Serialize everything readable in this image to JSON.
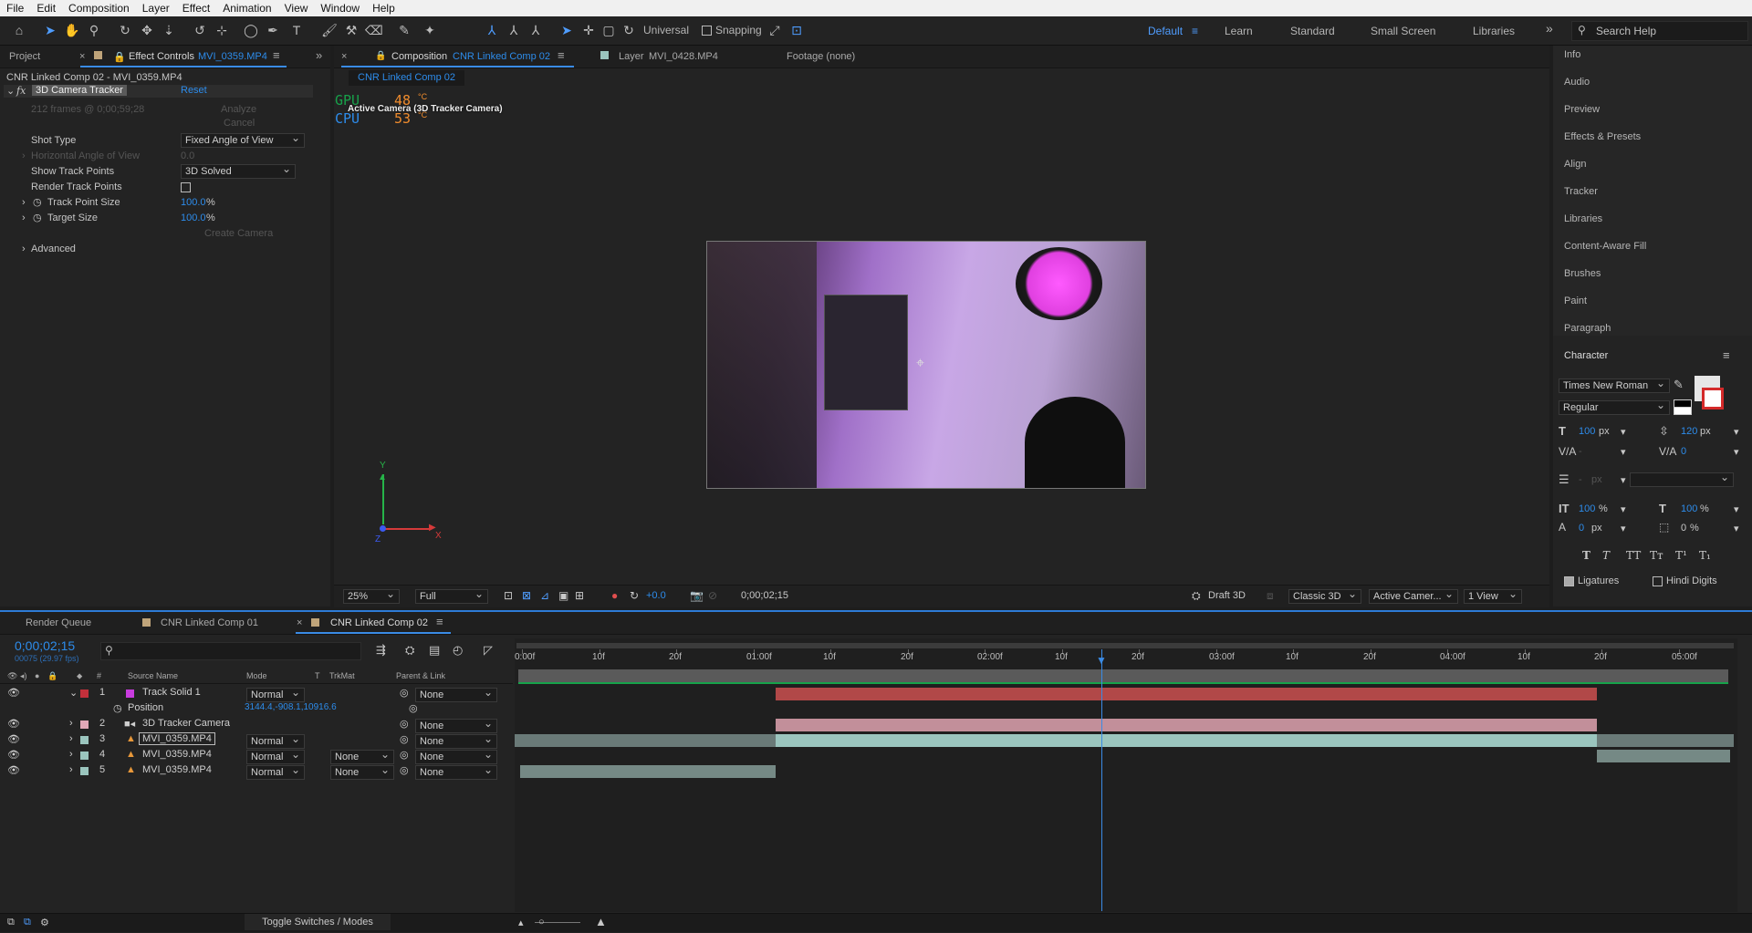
{
  "menu": [
    "File",
    "Edit",
    "Composition",
    "Layer",
    "Effect",
    "Animation",
    "View",
    "Window",
    "Help"
  ],
  "toolbar": {
    "universal_label": "Universal",
    "snapping_label": "Snapping",
    "workspaces": [
      "Default",
      "Learn",
      "Standard",
      "Small Screen",
      "Libraries"
    ],
    "active_workspace": "Default",
    "search_placeholder": "Search Help"
  },
  "left_panel": {
    "tabs": [
      "Project",
      "Effect Controls"
    ],
    "effect_controls_layer": "MVI_0359.MP4",
    "header": "CNR  Linked Comp 02 - MVI_0359.MP4",
    "effect_name": "3D Camera Tracker",
    "reset_label": "Reset",
    "frames_info": "212 frames @ 0;00;59;28",
    "analyze_label": "Analyze",
    "cancel_label": "Cancel",
    "shot_type_label": "Shot Type",
    "shot_type_value": "Fixed Angle of View",
    "hav_label": "Horizontal Angle of View",
    "hav_value": "0.0",
    "show_track_points_label": "Show Track Points",
    "show_track_points_value": "3D Solved",
    "render_track_points_label": "Render Track Points",
    "track_point_size_label": "Track Point Size",
    "track_point_size_value": "100.0",
    "target_size_label": "Target Size",
    "target_size_value": "100.0",
    "percent": "%",
    "create_camera_label": "Create Camera",
    "advanced_label": "Advanced"
  },
  "comp_panel": {
    "tab_prefix": "Composition",
    "tab_comp": "CNR  Linked Comp 02",
    "layer_tab_prefix": "Layer",
    "layer_tab_name": "MVI_0428.MP4",
    "footage_tab": "Footage (none)",
    "breadcrumb": "CNR  Linked Comp 02",
    "active_camera_label": "Active Camera (3D Tracker Camera)",
    "gpu_label": "GPU",
    "gpu_temp": "48",
    "cpu_label": "CPU",
    "cpu_temp": "53",
    "temp_unit": "°C",
    "axis_y": "Y",
    "axis_x": "X",
    "axis_z": "Z",
    "zoom": "25%",
    "resolution": "Full",
    "exposure": "+0.0",
    "timecode": "0;00;02;15",
    "renderer_label": "Draft 3D",
    "renderer": "Classic 3D",
    "camera_view": "Active Camer...",
    "views": "1 View"
  },
  "right_panel": {
    "items": [
      "Info",
      "Audio",
      "Preview",
      "Effects & Presets",
      "Align",
      "Tracker",
      "Libraries",
      "Content-Aware Fill",
      "Brushes",
      "Paint",
      "Paragraph"
    ],
    "character_title": "Character",
    "font_family": "Times New Roman",
    "font_style": "Regular",
    "font_size": "100",
    "leading": "120",
    "px": "px",
    "kerning": "-",
    "tracking": "0",
    "stroke_width": "-",
    "vert_scale": "100",
    "horiz_scale": "100",
    "baseline_shift": "0",
    "tsume": "0",
    "pct": "%",
    "ligatures_label": "Ligatures",
    "hindi_digits_label": "Hindi Digits",
    "style_buttons": [
      "T",
      "T",
      "TT",
      "Tт",
      "T¹",
      "T₁"
    ]
  },
  "timeline": {
    "tabs": [
      "Render Queue",
      "CNR  Linked Comp 01",
      "CNR  Linked Comp 02"
    ],
    "active_tab": "CNR  Linked Comp 02",
    "timecode": "0;00;02;15",
    "frame_info": "00075 (29.97 fps)",
    "columns": {
      "source_name": "Source Name",
      "mode": "Mode",
      "t": "T",
      "trkmat": "TrkMat",
      "parent": "Parent & Link"
    },
    "layers": [
      {
        "num": "1",
        "name": "Track Solid 1",
        "mode": "Normal",
        "trkmat": "",
        "parent": "None",
        "color": "#c2303b",
        "label_color": "#c83cde"
      },
      {
        "num": "2",
        "name": "3D Tracker Camera",
        "mode": "",
        "trkmat": "",
        "parent": "None",
        "color": "#e0a8b7",
        "label_color": "#8e8e8e"
      },
      {
        "num": "3",
        "name": "MVI_0359.MP4",
        "mode": "Normal",
        "trkmat": "",
        "parent": "None",
        "color": "#9bc5be",
        "label_color": "#e8983a"
      },
      {
        "num": "4",
        "name": "MVI_0359.MP4",
        "mode": "Normal",
        "trkmat": "None",
        "parent": "None",
        "color": "#9bc5be",
        "label_color": "#e8983a"
      },
      {
        "num": "5",
        "name": "MVI_0359.MP4",
        "mode": "Normal",
        "trkmat": "None",
        "parent": "None",
        "color": "#9bc5be",
        "label_color": "#e8983a"
      }
    ],
    "position_label": "Position",
    "position_value": "3144.4,-908.1,10916.6",
    "ruler_ticks": [
      "0:00f",
      "10f",
      "20f",
      "01:00f",
      "10f",
      "20f",
      "02:00f",
      "10f",
      "20f",
      "03:00f",
      "10f",
      "20f",
      "04:00f",
      "10f",
      "20f",
      "05:00f"
    ],
    "toggle_label": "Toggle Switches / Modes"
  }
}
